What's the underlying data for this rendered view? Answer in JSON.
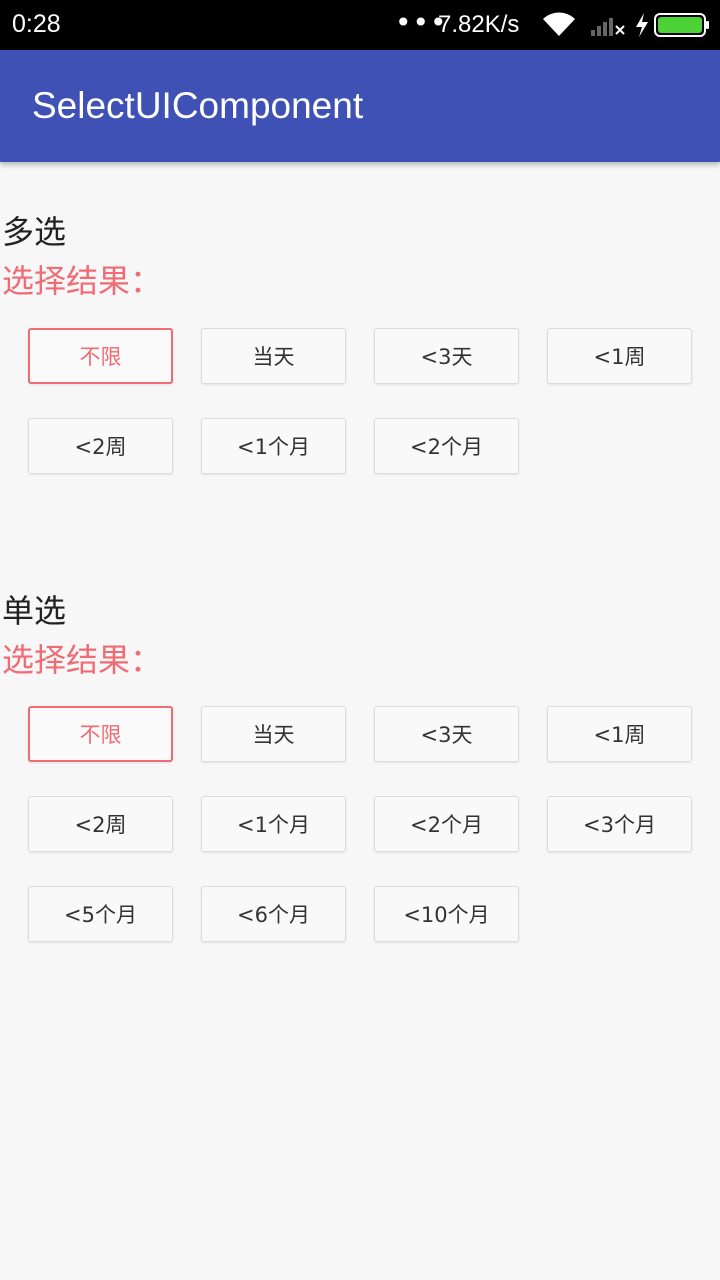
{
  "status_bar": {
    "time": "0:28",
    "dots": "•••",
    "speed": "7.82K/s",
    "icons": [
      "wifi-icon",
      "signal-icon",
      "charging-icon",
      "battery-icon"
    ],
    "battery_color": "#4cd137"
  },
  "app_bar": {
    "title": "SelectUIComponent",
    "color": "#3f51b5"
  },
  "multi": {
    "title": "多选",
    "result_label": "选择结果：",
    "options": [
      {
        "label": "不限",
        "selected": true
      },
      {
        "label": "当天",
        "selected": false
      },
      {
        "label": "<3天",
        "selected": false
      },
      {
        "label": "<1周",
        "selected": false
      },
      {
        "label": "<2周",
        "selected": false
      },
      {
        "label": "<1个月",
        "selected": false
      },
      {
        "label": "<2个月",
        "selected": false
      }
    ]
  },
  "single": {
    "title": "单选",
    "result_label": "选择结果：",
    "options": [
      {
        "label": "不限",
        "selected": true
      },
      {
        "label": "当天",
        "selected": false
      },
      {
        "label": "<3天",
        "selected": false
      },
      {
        "label": "<1周",
        "selected": false
      },
      {
        "label": "<2周",
        "selected": false
      },
      {
        "label": "<1个月",
        "selected": false
      },
      {
        "label": "<2个月",
        "selected": false
      },
      {
        "label": "<3个月",
        "selected": false
      },
      {
        "label": "<5个月",
        "selected": false
      },
      {
        "label": "<6个月",
        "selected": false
      },
      {
        "label": "<10个月",
        "selected": false
      }
    ]
  },
  "accent_color": "#f06b74"
}
